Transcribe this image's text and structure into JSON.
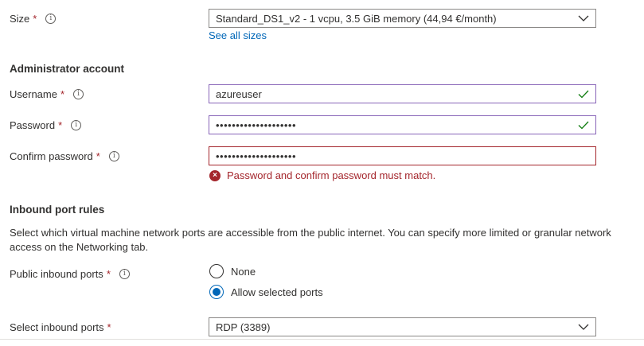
{
  "size": {
    "label": "Size",
    "required": "*",
    "info": "i",
    "value": "Standard_DS1_v2 - 1 vcpu, 3.5 GiB memory (44,94 €/month)",
    "see_all_link": "See all sizes"
  },
  "admin": {
    "section_title": "Administrator account",
    "username": {
      "label": "Username",
      "required": "*",
      "info": "i",
      "value": "azureuser",
      "status": "valid"
    },
    "password": {
      "label": "Password",
      "required": "*",
      "info": "i",
      "value": "••••••••••••••••••••",
      "status": "valid"
    },
    "confirm_password": {
      "label": "Confirm password",
      "required": "*",
      "info": "i",
      "value": "••••••••••••••••••••",
      "status": "error",
      "error_message": "Password and confirm password must match.",
      "error_icon": "×"
    }
  },
  "inbound": {
    "section_title": "Inbound port rules",
    "description": "Select which virtual machine network ports are accessible from the public internet. You can specify more limited or granular network access on the Networking tab.",
    "public_ports": {
      "label": "Public inbound ports",
      "required": "*",
      "info": "i",
      "options": [
        {
          "label": "None",
          "selected": false
        },
        {
          "label": "Allow selected ports",
          "selected": true
        }
      ]
    },
    "select_ports": {
      "label": "Select inbound ports",
      "required": "*",
      "value": "RDP (3389)"
    }
  },
  "colors": {
    "error": "#a4262c",
    "valid_border": "#8764b8",
    "valid_check": "#107c10",
    "link": "#0067b8",
    "radio_selected": "#0067b8"
  }
}
